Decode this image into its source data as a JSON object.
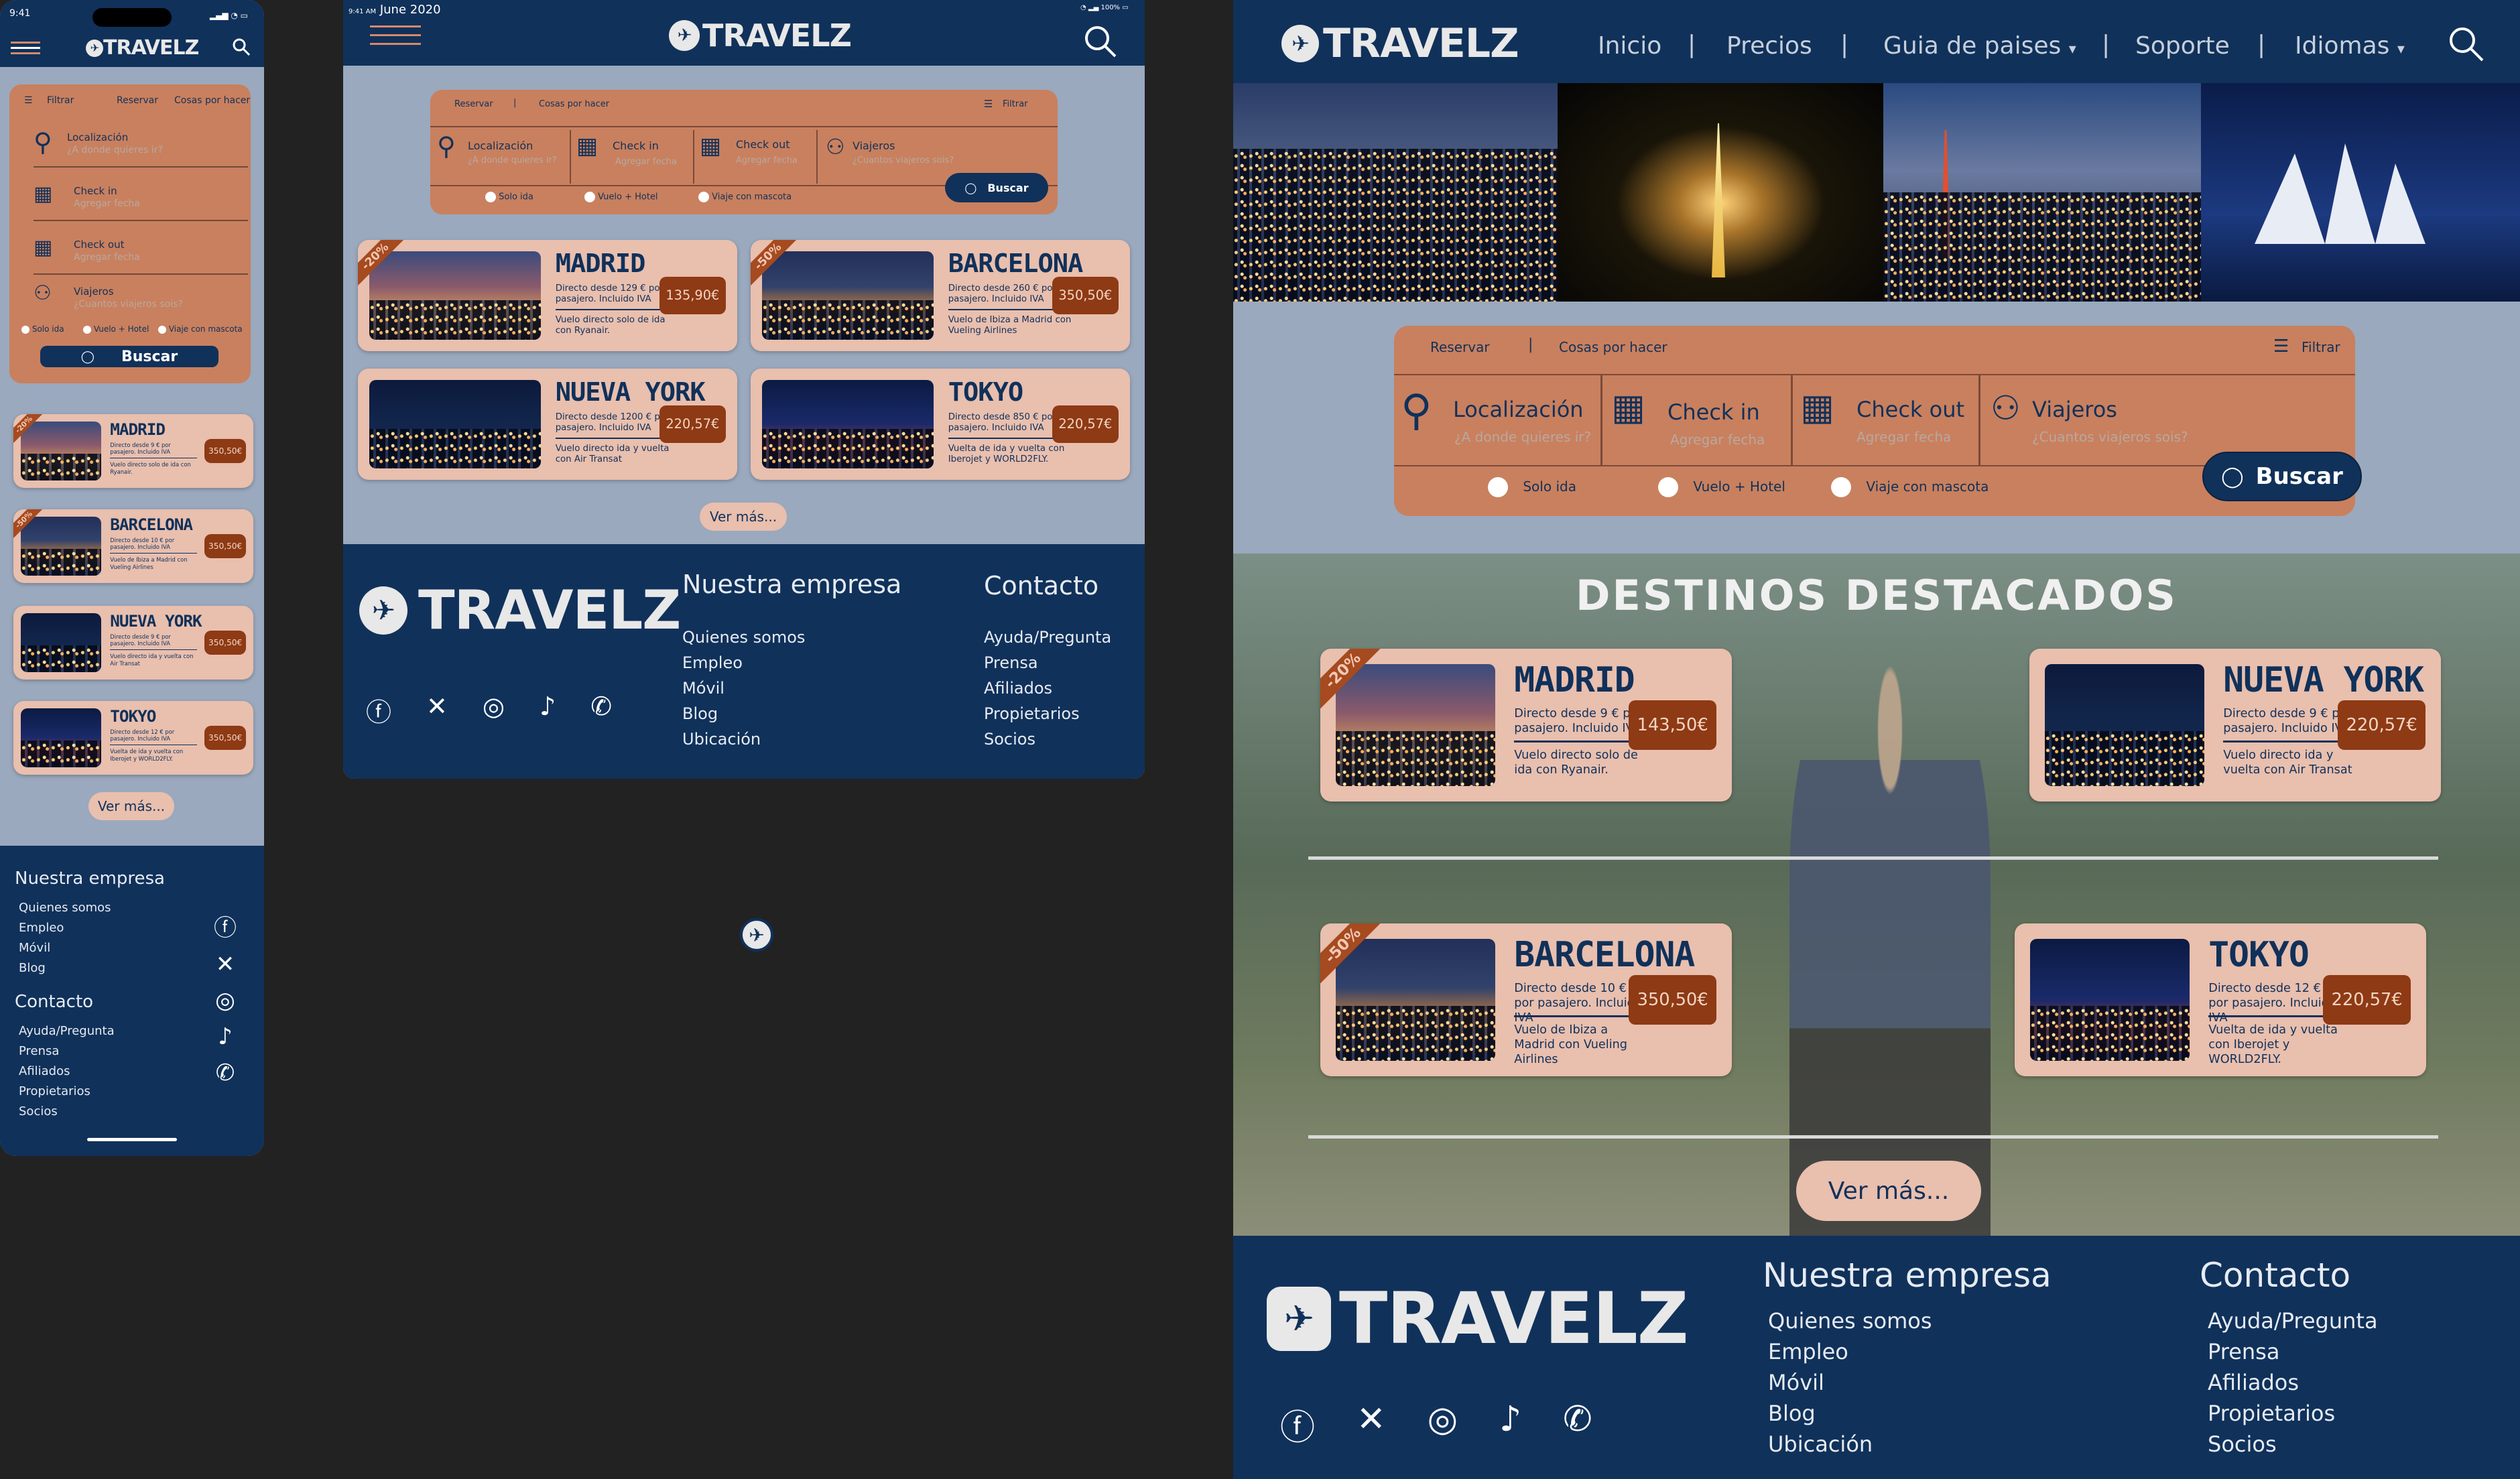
{
  "brand": "TRAVELZ",
  "nav": {
    "items": [
      "Inicio",
      "Precios",
      "Guia de paises",
      "Soporte",
      "Idiomas"
    ],
    "separator": "|"
  },
  "search": {
    "tabs": [
      "Reservar",
      "Cosas por hacer"
    ],
    "filter_label": "Filtrar",
    "fields": [
      {
        "label": "Localización",
        "placeholder": "¿A donde quieres ir?"
      },
      {
        "label": "Check in",
        "placeholder": "Agregar fecha"
      },
      {
        "label": "Check out",
        "placeholder": "Agregar fecha"
      },
      {
        "label": "Viajeros",
        "placeholder": "¿Cuantos viajeros sois?"
      }
    ],
    "options": [
      "Solo ida",
      "Vuelo + Hotel",
      "Viaje con mascota"
    ],
    "button": "Buscar"
  },
  "featured_title": "DESTINOS DESTACADOS",
  "more_button": "Ver más...",
  "desktop_destinations": [
    {
      "name": "MADRID",
      "desc": "Directo desde 9 € por pasajero. Incluido IVA",
      "note": "Vuelo directo solo de ida con Ryanair.",
      "price": "143,50€",
      "badge": "-20%"
    },
    {
      "name": "NUEVA YORK",
      "desc": "Directo desde 9 € por pasajero. Incluido IVA",
      "note": "Vuelo directo ida y vuelta con Air Transat",
      "price": "220,57€",
      "badge": ""
    },
    {
      "name": "BARCELONA",
      "desc": "Directo desde 10 € por pasajero. Incluido IVA",
      "note": "Vuelo de Ibiza a Madrid con Vueling Airlines",
      "price": "350,50€",
      "badge": "-50%"
    },
    {
      "name": "TOKYO",
      "desc": "Directo desde 12 € por pasajero. Incluido IVA",
      "note": "Vuelta de ida y vuelta con Iberojet y WORLD2FLY.",
      "price": "220,57€",
      "badge": ""
    }
  ],
  "tablet_destinations": [
    {
      "name": "MADRID",
      "desc": "Directo desde 129 € por pasajero. Incluido IVA",
      "note": "Vuelo directo solo de ida con Ryanair.",
      "price": "135,90€",
      "badge": "-20%"
    },
    {
      "name": "BARCELONA",
      "desc": "Directo desde 260 € por pasajero. Incluido IVA",
      "note": "Vuelo de Ibiza a Madrid con Vueling Airlines",
      "price": "350,50€",
      "badge": "-50%"
    },
    {
      "name": "NUEVA YORK",
      "desc": "Directo desde 1200 € por pasajero. Incluido IVA",
      "note": "Vuelo directo ida y vuelta con Air Transat",
      "price": "220,57€",
      "badge": ""
    },
    {
      "name": "TOKYO",
      "desc": "Directo desde 850 € por pasajero. Incluido IVA",
      "note": "Vuelta de ida y vuelta con Iberojet y WORLD2FLY.",
      "price": "220,57€",
      "badge": ""
    }
  ],
  "mobile_destinations": [
    {
      "name": "MADRID",
      "desc": "Directo desde 9 € por pasajero. Incluido IVA",
      "note": "Vuelo directo solo de ida con Ryanair.",
      "price": "350,50€",
      "badge": "-20%"
    },
    {
      "name": "BARCELONA",
      "desc": "Directo desde 10 € por pasajero. Incluido IVA",
      "note": "Vuelo de Ibiza a Madrid con Vueling Airlines",
      "price": "350,50€",
      "badge": "-50%"
    },
    {
      "name": "NUEVA YORK",
      "desc": "Directo desde 9 € por pasajero. Incluido IVA",
      "note": "Vuelo directo ida y vuelta con Air Transat",
      "price": "350,50€",
      "badge": ""
    },
    {
      "name": "TOKYO",
      "desc": "Directo desde 12 € por pasajero. Incluido IVA",
      "note": "Vuelta de ida y vuelta con Iberojet y WORLD2FLY.",
      "price": "350,50€",
      "badge": ""
    }
  ],
  "footer": {
    "company_title": "Nuestra empresa",
    "company_links": [
      "Quienes somos",
      "Empleo",
      "Móvil",
      "Blog",
      "Ubicación"
    ],
    "contact_title": "Contacto",
    "contact_links": [
      "Ayuda/Pregunta",
      "Prensa",
      "Afiliados",
      "Propietarios",
      "Socios"
    ],
    "social_icons": [
      "facebook-icon",
      "x-icon",
      "instagram-icon",
      "tiktok-icon",
      "whatsapp-icon"
    ]
  },
  "mobile_status": {
    "time": "9:41"
  },
  "tablet_status": {
    "time": "9:41 AM",
    "date": "June 2020",
    "battery": "100%"
  },
  "colors": {
    "navy": "#10315a",
    "orange": "#c9805e",
    "card": "#e9bfae",
    "price": "#8e3a14",
    "page_bg": "#9aa9bd"
  }
}
